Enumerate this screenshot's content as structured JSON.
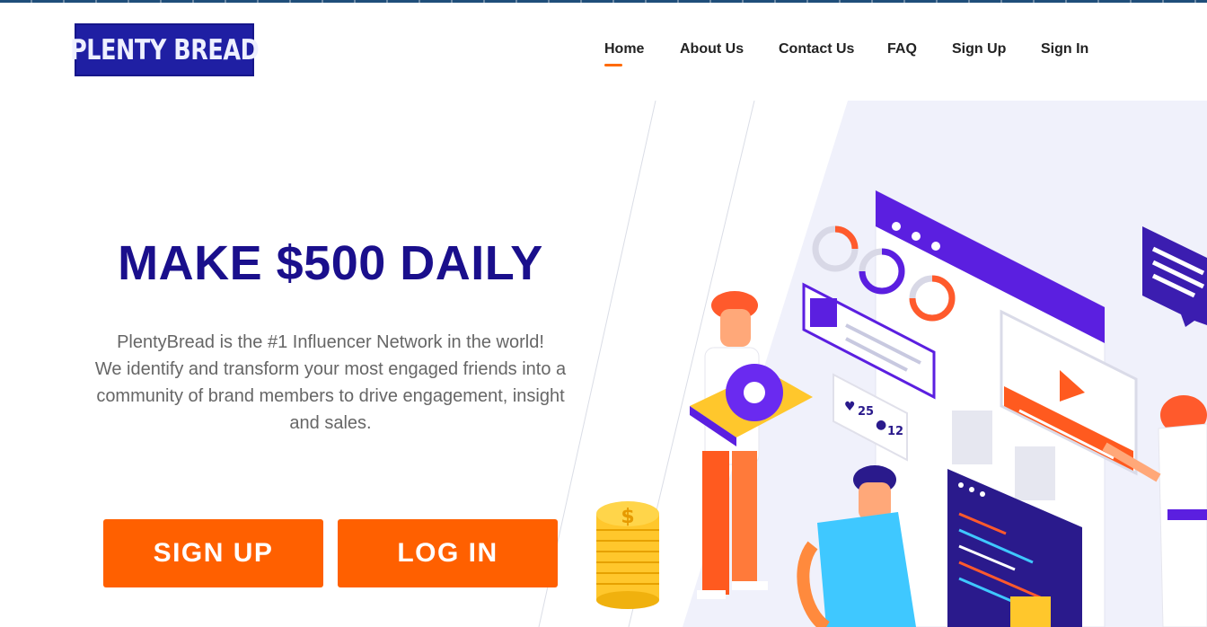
{
  "brand": {
    "logo_text": "PLENTY BREAD"
  },
  "nav": {
    "items": [
      {
        "label": "Home",
        "active": true
      },
      {
        "label": "About Us"
      },
      {
        "label": "Contact Us"
      },
      {
        "label": "FAQ"
      },
      {
        "label": "Sign Up"
      },
      {
        "label": "Sign In"
      }
    ]
  },
  "hero": {
    "headline": "MAKE $500 DAILY",
    "description_line1": "PlentyBread is the #1 Influencer Network in the world!",
    "description_line2": "We identify and transform your most engaged friends into a community of brand members to drive engagement, insight and sales.",
    "signup_label": "SIGN UP",
    "login_label": "LOG IN"
  },
  "illustration": {
    "likes_count": "25",
    "comments_count": "12",
    "coin_symbol": "$"
  },
  "colors": {
    "brand_blue": "#1a0f8c",
    "accent_orange": "#ff6000",
    "purple": "#5b1fe0"
  }
}
